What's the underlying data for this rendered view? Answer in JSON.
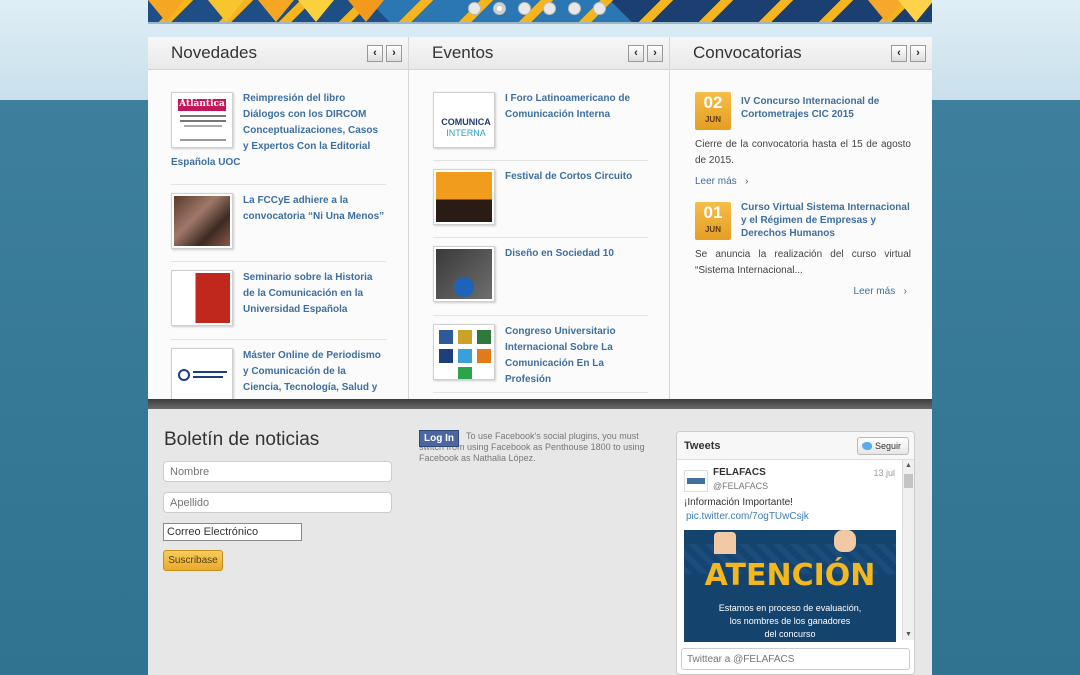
{
  "banner": {
    "dots": 6,
    "active_dot": 2
  },
  "columns": {
    "novedades": {
      "title": "Novedades",
      "items": [
        {
          "title": "Reimpresión del libro Diálogos con los DIRCOM Conceptualizaciones, Casos y Expertos Con la Editorial",
          "tail": "Española UOC"
        },
        {
          "title": "La FCCyE adhiere a la convocatoria “Ni Una Menos”"
        },
        {
          "title": "Seminario sobre la Historia de la Comunicación en la Universidad Española"
        },
        {
          "title": "Máster Online de Periodismo y Comunicación de la Ciencia, Tecnología, Salud y"
        }
      ]
    },
    "eventos": {
      "title": "Eventos",
      "items": [
        {
          "title": "I Foro Latinoamericano de Comunicación Interna"
        },
        {
          "title": "Festival de Cortos Circuito"
        },
        {
          "title": "Diseño en Sociedad 10"
        },
        {
          "title": "Congreso Universitario Internacional Sobre La Comunicación En La Profesión"
        }
      ]
    },
    "convocatorias": {
      "title": "Convocatorias",
      "items": [
        {
          "day": "02",
          "month": "JUN",
          "title": "IV Concurso Internacional de Cortometrajes CIC 2015",
          "text": "Cierre de la convocatoria hasta el 15 de agosto de 2015.",
          "more": "Leer más"
        },
        {
          "day": "01",
          "month": "JUN",
          "title": "Curso Virtual Sistema Internacional y el Régimen de Empresas y Derechos Humanos",
          "text": "Se anuncia la realización del curso virtual “Sistema Internacional...",
          "more": "Leer más"
        }
      ]
    }
  },
  "newsletter": {
    "title": "Boletín de noticias",
    "nombre_placeholder": "Nombre",
    "apellido_placeholder": "Apellido",
    "email_value": "Correo Electrónico",
    "subscribe": "Suscribase"
  },
  "facebook": {
    "login": "Log In",
    "text": "To use Facebook's social plugins, you must switch from using Facebook as Penthouse 1800 to using Facebook as Nathalia López."
  },
  "twitter": {
    "title": "Tweets",
    "follow": "Seguir",
    "tweet": {
      "name": "FELAFACS",
      "handle": "@FELAFACS",
      "date": "13 jul",
      "text": "¡Información Importante!",
      "link": "pic.twitter.com/7ogTUwCsjk",
      "image_headline": "ATENCIÓN",
      "image_line1": "Estamos en proceso de evaluación,",
      "image_line2": "los nombres de los ganadores",
      "image_line3": "del concurso"
    },
    "compose_placeholder": "Twittear a @FELAFACS"
  }
}
